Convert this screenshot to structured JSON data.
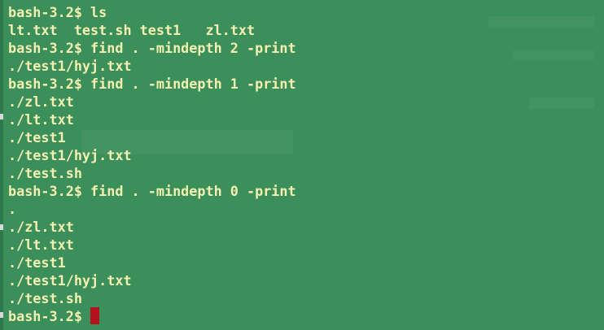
{
  "terminal": {
    "prompt": "bash-3.2$ ",
    "lines": [
      "bash-3.2$ ls",
      "lt.txt  test.sh test1   zl.txt",
      "bash-3.2$ find . -mindepth 2 -print",
      "./test1/hyj.txt",
      "bash-3.2$ find . -mindepth 1 -print",
      "./zl.txt",
      "./lt.txt",
      "./test1",
      "./test1/hyj.txt",
      "./test.sh",
      "bash-3.2$ find . -mindepth 0 -print",
      ".",
      "./zl.txt",
      "./lt.txt",
      "./test1",
      "./test1/hyj.txt",
      "./test.sh"
    ],
    "colors": {
      "background": "#3a8f5b",
      "text": "#f4f0b0",
      "cursor": "#b3121c"
    }
  }
}
